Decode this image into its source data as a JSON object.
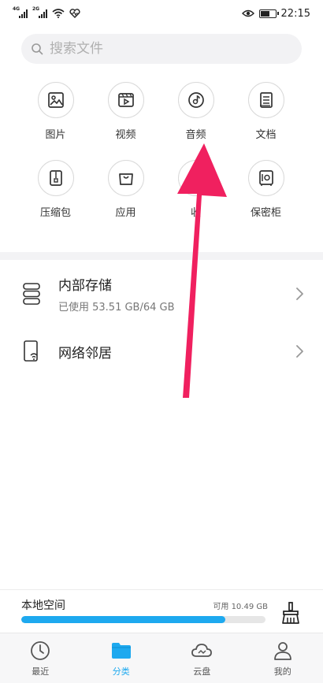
{
  "status_bar": {
    "signal1_gen": "4G",
    "signal2_gen": "2G",
    "time": "22:15",
    "icons": [
      "signal-icon",
      "signal-icon",
      "wifi-icon",
      "heartbeat-icon",
      "eye-icon",
      "battery-icon"
    ]
  },
  "search": {
    "placeholder": "搜索文件",
    "icon": "search-icon"
  },
  "categories": [
    {
      "label": "图片",
      "icon": "image-icon"
    },
    {
      "label": "视频",
      "icon": "video-icon"
    },
    {
      "label": "音频",
      "icon": "audio-icon"
    },
    {
      "label": "文档",
      "icon": "document-icon"
    },
    {
      "label": "压缩包",
      "icon": "zip-icon"
    },
    {
      "label": "应用",
      "icon": "app-bag-icon"
    },
    {
      "label": "收",
      "icon": "favorites-icon"
    },
    {
      "label": "保密柜",
      "icon": "safe-icon"
    }
  ],
  "storage": {
    "internal": {
      "title": "内部存储",
      "usage": "已使用 53.51 GB/64 GB",
      "icon": "storage-icon"
    },
    "network": {
      "title": "网络邻居",
      "icon": "network-phone-icon"
    }
  },
  "local_space": {
    "label": "本地空间",
    "available": "可用 10.49 GB",
    "used_fraction": 0.836,
    "icon": "broom-icon"
  },
  "bottom_nav": {
    "items": [
      {
        "label": "最近",
        "icon": "clock-icon",
        "active": false
      },
      {
        "label": "分类",
        "icon": "folder-icon",
        "active": true
      },
      {
        "label": "云盘",
        "icon": "cloud-icon",
        "active": false
      },
      {
        "label": "我的",
        "icon": "person-icon",
        "active": false
      }
    ]
  },
  "colors": {
    "accent": "#1ea9ef",
    "annotation_arrow": "#f0205f",
    "icon_stroke": "#333333"
  }
}
